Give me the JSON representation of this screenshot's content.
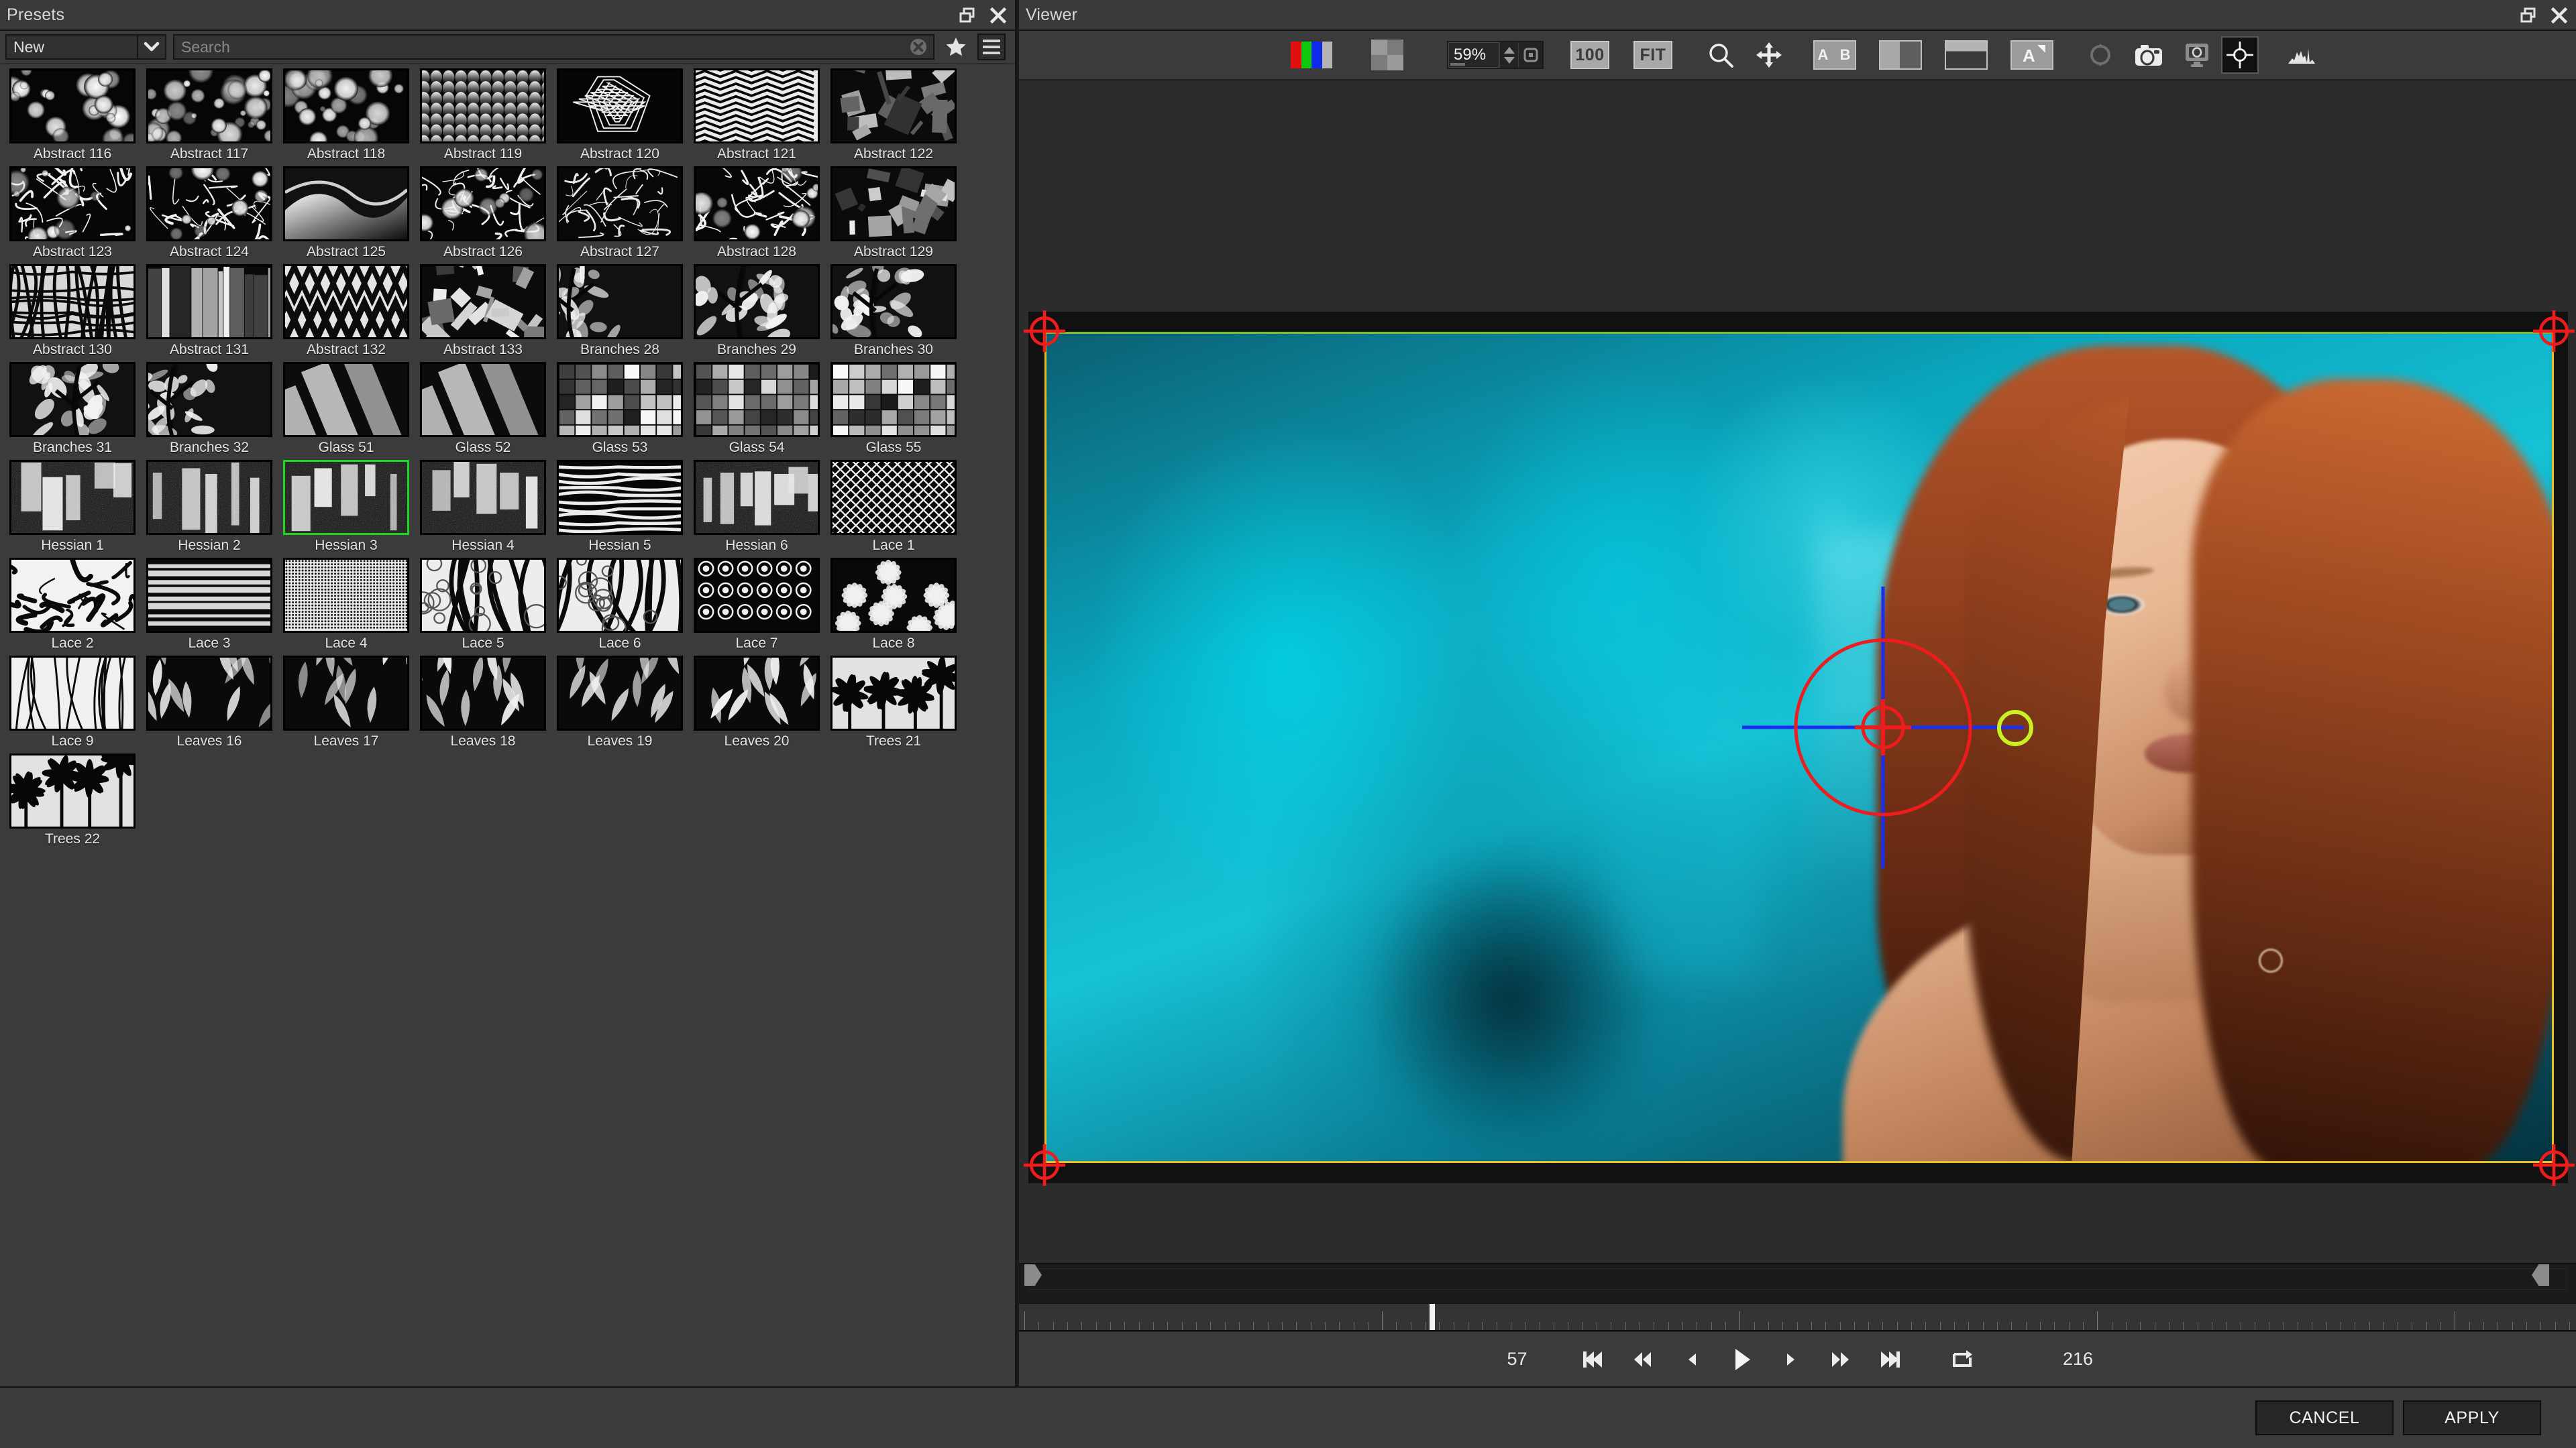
{
  "presets_panel": {
    "title": "Presets",
    "window_controls": {
      "restore": "restore-window",
      "close": "close-window"
    },
    "toolbar": {
      "category_value": "New",
      "search_value": "",
      "search_placeholder": "Search",
      "clear_icon": "clear-circle-x-icon",
      "favorite_icon": "star-icon",
      "menu_icon": "hamburger-menu-icon"
    },
    "selected_preset": "Hessian 3",
    "rows": [
      [
        {
          "label": "Abstract 116",
          "style": "bokeh-a"
        },
        {
          "label": "Abstract 117",
          "style": "bokeh-b"
        },
        {
          "label": "Abstract 118",
          "style": "bokeh-c"
        },
        {
          "label": "Abstract 119",
          "style": "scales"
        },
        {
          "label": "Abstract 120",
          "style": "hexline"
        },
        {
          "label": "Abstract 121",
          "style": "zigzag"
        },
        {
          "label": "Abstract 122",
          "style": "shard"
        }
      ],
      [
        {
          "label": "Abstract 123",
          "style": "crackle"
        },
        {
          "label": "Abstract 124",
          "style": "splatter"
        },
        {
          "label": "Abstract 125",
          "style": "fold"
        },
        {
          "label": "Abstract 126",
          "style": "ink"
        },
        {
          "label": "Abstract 127",
          "style": "feather"
        },
        {
          "label": "Abstract 128",
          "style": "splatter2"
        },
        {
          "label": "Abstract 129",
          "style": "shard2"
        }
      ],
      [
        {
          "label": "Abstract 130",
          "style": "mesh"
        },
        {
          "label": "Abstract 131",
          "style": "slab"
        },
        {
          "label": "Abstract 132",
          "style": "weave"
        },
        {
          "label": "Abstract 133",
          "style": "facet"
        },
        {
          "label": "Branches 28",
          "style": "branch-a"
        },
        {
          "label": "Branches 29",
          "style": "branch-b"
        },
        {
          "label": "Branches 30",
          "style": "branch-c"
        }
      ],
      [
        {
          "label": "Branches 31",
          "style": "branch-d"
        },
        {
          "label": "Branches 32",
          "style": "branch-e"
        },
        {
          "label": "Glass 51",
          "style": "glass-a"
        },
        {
          "label": "Glass 52",
          "style": "glass-b"
        },
        {
          "label": "Glass 53",
          "style": "glass-c"
        },
        {
          "label": "Glass 54",
          "style": "glass-d"
        },
        {
          "label": "Glass 55",
          "style": "glass-e"
        }
      ],
      [
        {
          "label": "Hessian 1",
          "style": "hess-a"
        },
        {
          "label": "Hessian 2",
          "style": "hess-b"
        },
        {
          "label": "Hessian 3",
          "style": "hess-c"
        },
        {
          "label": "Hessian 4",
          "style": "hess-d"
        },
        {
          "label": "Hessian 5",
          "style": "hess-e"
        },
        {
          "label": "Hessian 6",
          "style": "hess-f"
        },
        {
          "label": "Lace 1",
          "style": "lace-a"
        }
      ],
      [
        {
          "label": "Lace 2",
          "style": "lace-b"
        },
        {
          "label": "Lace 3",
          "style": "lace-c"
        },
        {
          "label": "Lace 4",
          "style": "lace-d"
        },
        {
          "label": "Lace 5",
          "style": "lace-e"
        },
        {
          "label": "Lace 6",
          "style": "lace-f"
        },
        {
          "label": "Lace 7",
          "style": "lace-g"
        },
        {
          "label": "Lace 8",
          "style": "lace-h"
        }
      ],
      [
        {
          "label": "Lace 9",
          "style": "lace-i"
        },
        {
          "label": "Leaves 16",
          "style": "leaf-a"
        },
        {
          "label": "Leaves 17",
          "style": "leaf-b"
        },
        {
          "label": "Leaves 18",
          "style": "leaf-c"
        },
        {
          "label": "Leaves 19",
          "style": "leaf-d"
        },
        {
          "label": "Leaves 20",
          "style": "leaf-e"
        },
        {
          "label": "Trees 21",
          "style": "tree-a"
        }
      ],
      [
        {
          "label": "Trees 22",
          "style": "tree-b"
        }
      ]
    ]
  },
  "viewer": {
    "title": "Viewer",
    "window_controls": {
      "restore": "restore-window",
      "close": "close-window"
    },
    "toolbar": {
      "channels_icon": "rgb-channels-icon",
      "alpha_checker_icon": "alpha-checkerboard-icon",
      "zoom_value": "59%",
      "zoom_stepper_icon": "zoom-stepper-icon",
      "zoom_reset_icon": "zoom-reset-icon",
      "zoom_100_label": "100",
      "zoom_fit_label": "FIT",
      "magnifier_icon": "magnifier-icon",
      "pan_icon": "pan-move-icon",
      "ab_compare_label": "A B",
      "split_vertical_icon": "split-vertical-icon",
      "split_horizontal_icon": "split-horizontal-icon",
      "text_overlay_icon": "text-overlay-icon",
      "refresh_icon": "refresh-cycle-icon",
      "snapshot_icon": "camera-snapshot-icon",
      "monitor_out_icon": "monitor-output-icon",
      "target_icon": "target-crosshair-icon",
      "histogram_icon": "histogram-icon"
    },
    "overlay": {
      "crop_border_color": "#e8c21a",
      "crop_top_accent_color": "#7fbf2f",
      "handle_color": "#ee1c1c",
      "crosshair_color": "#1a2ef0",
      "drag_handle_color": "#c8f024"
    },
    "transport": {
      "current_frame": "57",
      "total_frames": "216",
      "buttons": [
        {
          "name": "skip-to-start-button",
          "icon": "skip-start-icon"
        },
        {
          "name": "rewind-button",
          "icon": "rewind-icon"
        },
        {
          "name": "step-back-button",
          "icon": "step-back-icon"
        },
        {
          "name": "play-button",
          "icon": "play-icon"
        },
        {
          "name": "step-forward-button",
          "icon": "step-forward-icon"
        },
        {
          "name": "fast-forward-button",
          "icon": "fast-forward-icon"
        },
        {
          "name": "skip-to-end-button",
          "icon": "skip-end-icon"
        },
        {
          "name": "loop-button",
          "icon": "loop-icon"
        }
      ]
    }
  },
  "bottom_bar": {
    "cancel_label": "CANCEL",
    "apply_label": "APPLY"
  }
}
